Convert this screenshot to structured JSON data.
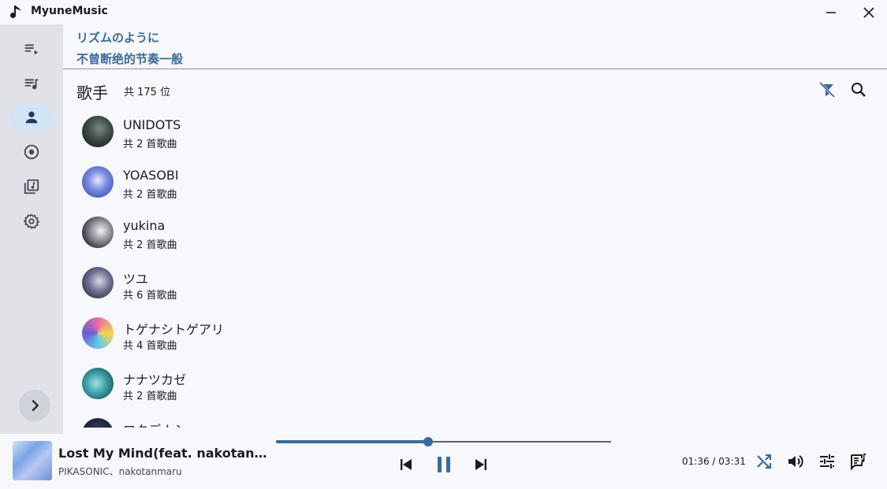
{
  "window": {
    "title": "MyuneMusic"
  },
  "sidebar": {
    "items": [
      {
        "name": "now-playing-queue",
        "icon": "playlist-play-icon"
      },
      {
        "name": "playlists",
        "icon": "queue-music-icon"
      },
      {
        "name": "artists",
        "icon": "person-icon",
        "active": true
      },
      {
        "name": "albums",
        "icon": "album-icon"
      },
      {
        "name": "library",
        "icon": "library-music-icon"
      },
      {
        "name": "settings",
        "icon": "gear-icon"
      }
    ],
    "expand_icon": "chevron-right-icon"
  },
  "lyrics": {
    "line1": "リズムのように",
    "line2": "不曾断绝的节奏一般"
  },
  "page": {
    "title": "歌手",
    "count": "共 175 位"
  },
  "artists": [
    {
      "name": "UNIDOTS",
      "count": "共 2 首歌曲"
    },
    {
      "name": "YOASOBI",
      "count": "共 2 首歌曲"
    },
    {
      "name": "yukina",
      "count": "共 2 首歌曲"
    },
    {
      "name": "ツユ",
      "count": "共 6 首歌曲"
    },
    {
      "name": "トゲナシトゲアリ",
      "count": "共 4 首歌曲"
    },
    {
      "name": "ナナツカゼ",
      "count": "共 2 首歌曲"
    },
    {
      "name": "ロクデナシ",
      "count": ""
    }
  ],
  "player": {
    "title": "Lost My Mind(feat. nakotanmaru)",
    "artist": "PIKASONIC、nakotanmaru",
    "time": "01:36 / 03:31",
    "progress": 0.455
  },
  "colors": {
    "accent": "#3b6a99",
    "sidebar_bg": "#e1e2e7",
    "active_pill": "#d3e4f7",
    "background": "#f7f8fc"
  }
}
